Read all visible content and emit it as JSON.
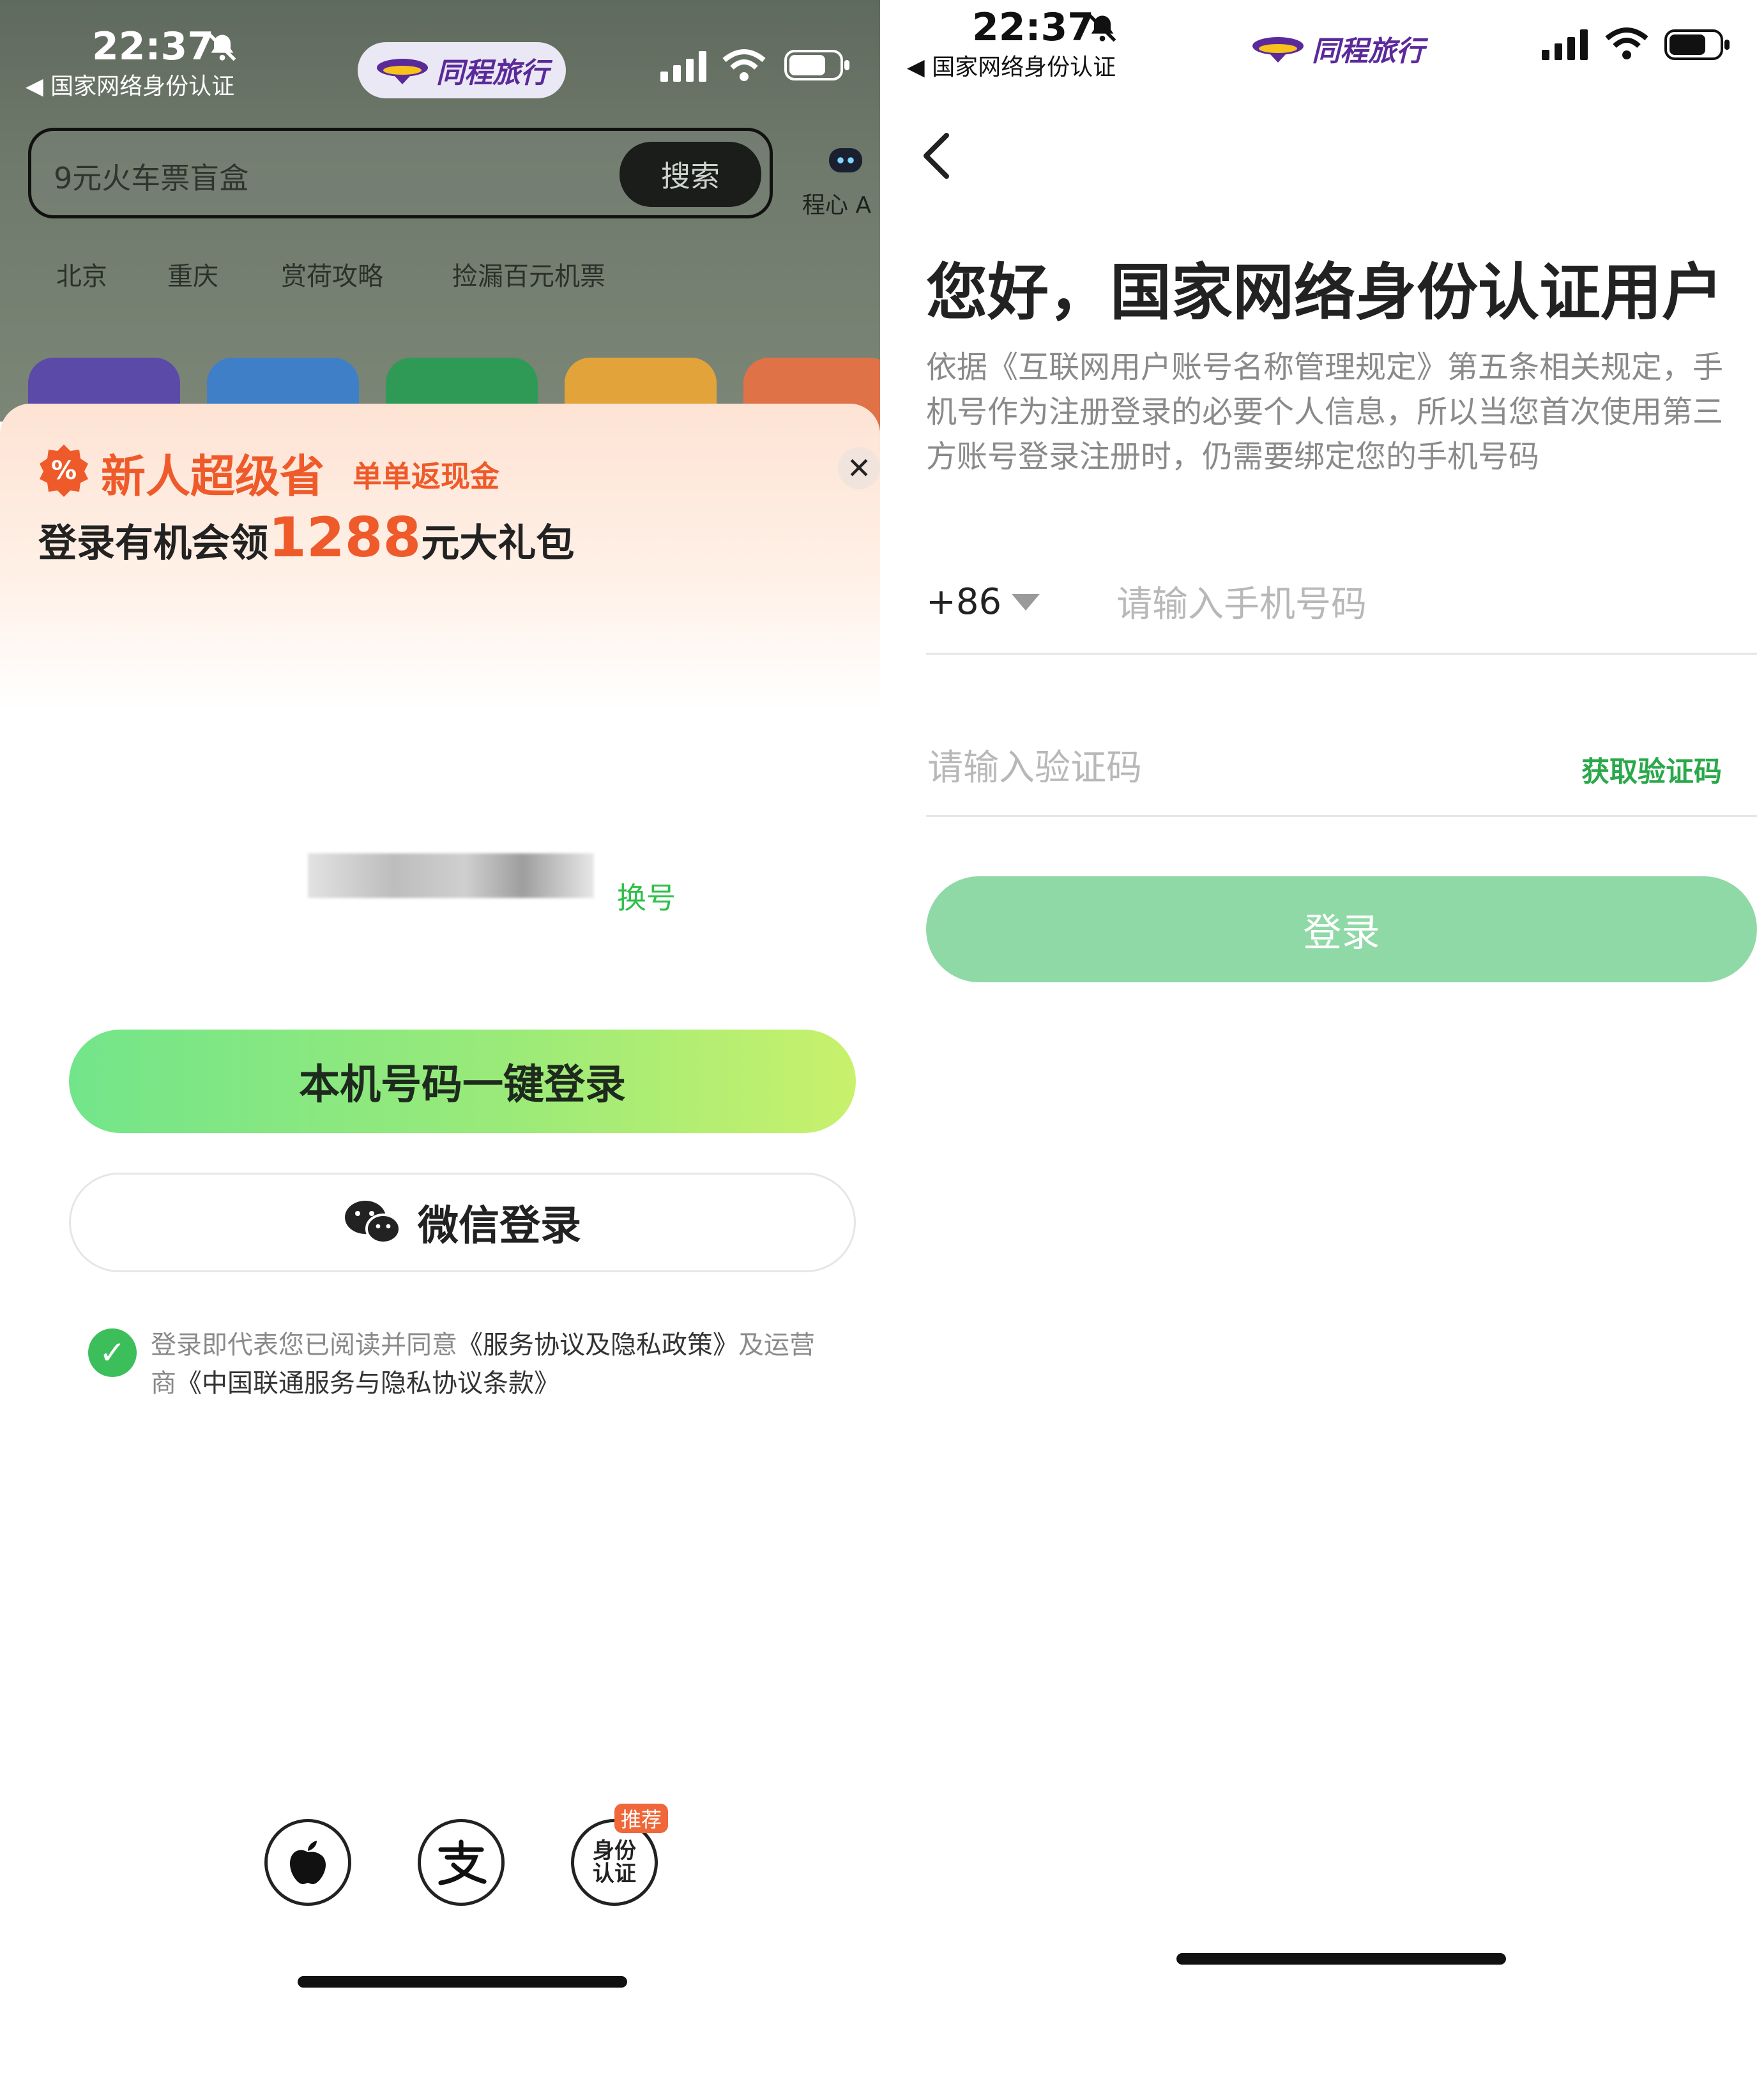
{
  "left": {
    "status_bar": {
      "time": "22:37",
      "back_label": "◀ 国家网络身份认证"
    },
    "brand": {
      "name": "同程旅行"
    },
    "search": {
      "placeholder": "9元火车票盲盒",
      "button": "搜索",
      "ai_label": "程心 A"
    },
    "hot_tags": [
      "北京",
      "重庆",
      "赏荷攻略",
      "捡漏百元机票"
    ],
    "promo": {
      "title": "新人超级省",
      "subtitle": "单单返现金",
      "line_prefix": "登录有机会领",
      "amount": "1288",
      "line_suffix": "元大礼包"
    },
    "masked_phone_suffix": "换号",
    "one_click_login": "本机号码一键登录",
    "wechat_login": "微信登录",
    "agreement": {
      "prefix": "登录即代表您已阅读并同意",
      "link1": "《服务协议及隐私政策》",
      "mid": "及运营商",
      "link2": "《中国联通服务与隐私协议条款》"
    },
    "third_party": {
      "idcard_label": "身份认证",
      "badge": "推荐"
    }
  },
  "right": {
    "status_bar": {
      "time": "22:37",
      "back_label": "◀ 国家网络身份认证"
    },
    "brand": {
      "name": "同程旅行"
    },
    "title": "您好，国家网络身份认证用户",
    "description": "依据《互联网用户账号名称管理规定》第五条相关规定，手机号作为注册登录的必要个人信息，所以当您首次使用第三方账号登录注册时，仍需要绑定您的手机号码",
    "country_code": "+86",
    "phone_placeholder": "请输入手机号码",
    "code_placeholder": "请输入验证码",
    "get_code": "获取验证码",
    "login_button": "登录"
  },
  "colors": {
    "accent_green": "#3cbf5a",
    "promo_orange": "#ef5a2a",
    "brand_purple": "#5b2a9a",
    "login_disabled": "#8fd9a6"
  }
}
